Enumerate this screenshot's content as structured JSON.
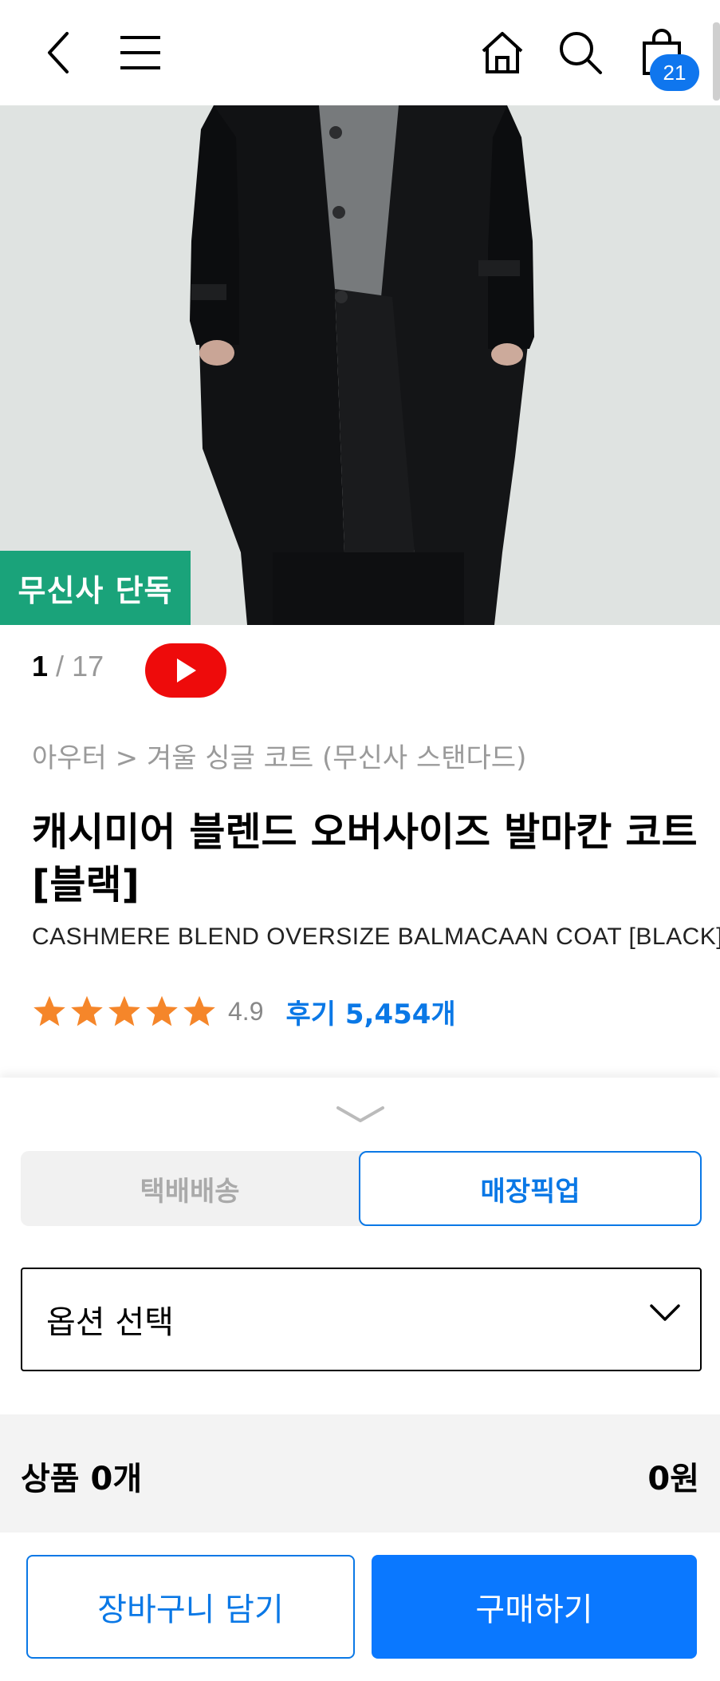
{
  "header": {
    "cart_count": "21",
    "icons": [
      "back-icon",
      "menu-icon",
      "home-icon",
      "search-icon",
      "shopping-bag-icon"
    ]
  },
  "hero": {
    "badge": "무신사 단독"
  },
  "gallery": {
    "current": "1",
    "separator": "/",
    "total": "17"
  },
  "product": {
    "breadcrumb": "아우터 > 겨울 싱글 코트 (무신사 스탠다드)",
    "title": "캐시미어 블렌드 오버사이즈 발마칸 코트 [블랙]",
    "subtitle": "CASHMERE BLEND OVERSIZE BALMACAAN COAT [BLACK]",
    "rating": "4.9",
    "stars": 5,
    "reviews": "후기 5,454개"
  },
  "purchase": {
    "delivery_tabs": [
      "택배배송",
      "매장픽업"
    ],
    "selected_tab": "매장픽업",
    "option_placeholder": "옵션 선택",
    "summary_count": "상품 0개",
    "summary_price": "0원",
    "add_to_cart": "장바구니 담기",
    "buy_now": "구매하기"
  },
  "colors": {
    "accent": "#0a78e6",
    "badge_green": "#1aa37a",
    "youtube_red": "#ee0b0b",
    "star": "#f5862a"
  }
}
